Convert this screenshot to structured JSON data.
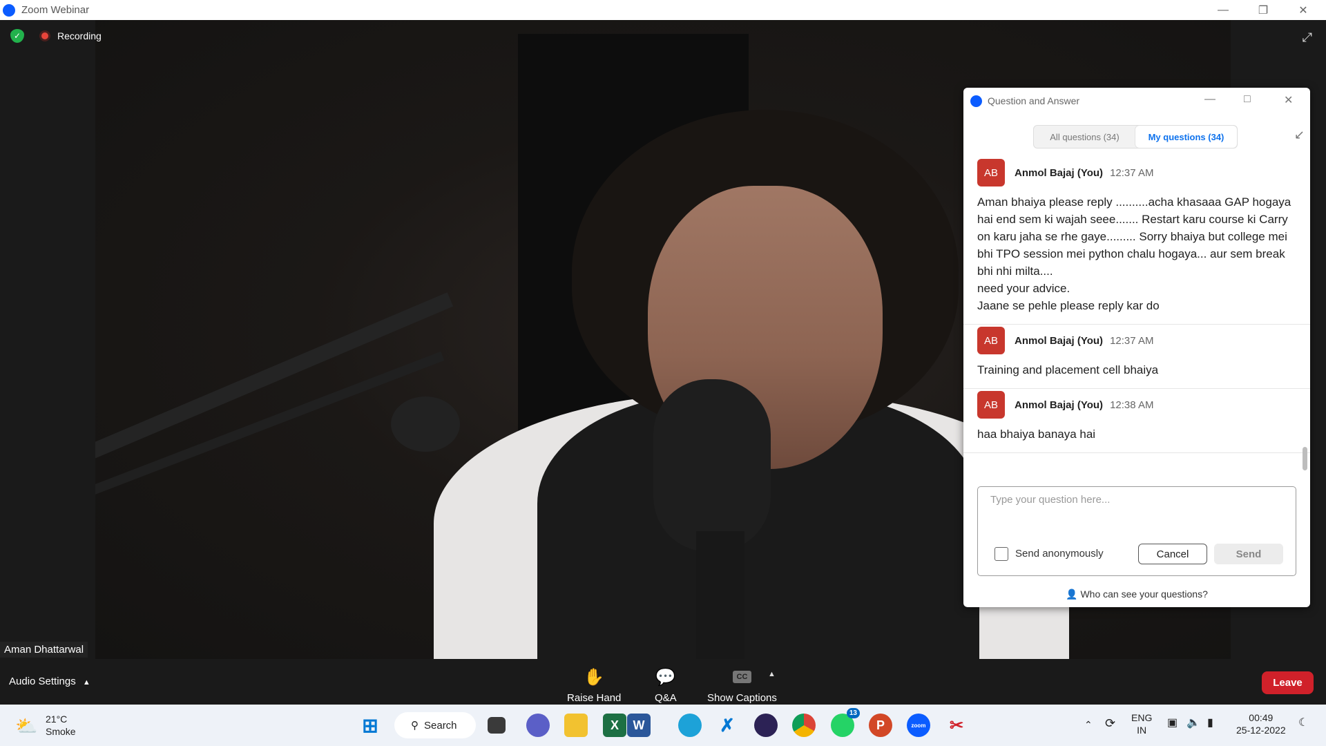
{
  "window": {
    "title": "Zoom Webinar"
  },
  "meeting": {
    "recording_label": "Recording",
    "speaker_name": "Aman Dhattarwal"
  },
  "qa_panel": {
    "title": "Question and Answer",
    "tabs": [
      {
        "label": "All questions (34)",
        "active": false
      },
      {
        "label": "My questions (34)",
        "active": true
      }
    ],
    "questions": [
      {
        "initials": "AB",
        "author": "Anmol Bajaj (You)",
        "time": "12:37 AM",
        "text": "Aman bhaiya please reply  ..........acha khasaaa GAP hogaya hai end sem ki wajah seee....... Restart karu course ki Carry on karu jaha se rhe gaye......... Sorry bhaiya but college mei bhi TPO session mei python chalu hogaya... aur sem break bhi nhi milta....\nneed your advice.\nJaane se pehle please reply kar do"
      },
      {
        "initials": "AB",
        "author": "Anmol Bajaj (You)",
        "time": "12:37 AM",
        "text": "Training and placement cell bhaiya"
      },
      {
        "initials": "AB",
        "author": "Anmol Bajaj (You)",
        "time": "12:38 AM",
        "text": "haa bhaiya banaya hai"
      }
    ],
    "compose": {
      "placeholder": "Type your question here...",
      "anonymous_label": "Send anonymously",
      "cancel_label": "Cancel",
      "send_label": "Send"
    },
    "privacy_link": "Who can see your questions?"
  },
  "toolbar": {
    "audio_settings": "Audio Settings",
    "raise_hand": "Raise Hand",
    "qa": "Q&A",
    "captions": "Show Captions",
    "cc_icon_text": "CC",
    "leave": "Leave"
  },
  "taskbar": {
    "weather_temp": "21°C",
    "weather_desc": "Smoke",
    "search_label": "Search",
    "whatsapp_badge": "13",
    "lang_top": "ENG",
    "lang_bottom": "IN",
    "time": "00:49",
    "date": "25-12-2022",
    "zoom_icon_text": "zoom"
  },
  "colors": {
    "zoom_blue": "#0b5cff",
    "leave_red": "#d0212a",
    "avatar_red": "#c8372d",
    "active_tab_blue": "#0e72ed"
  }
}
